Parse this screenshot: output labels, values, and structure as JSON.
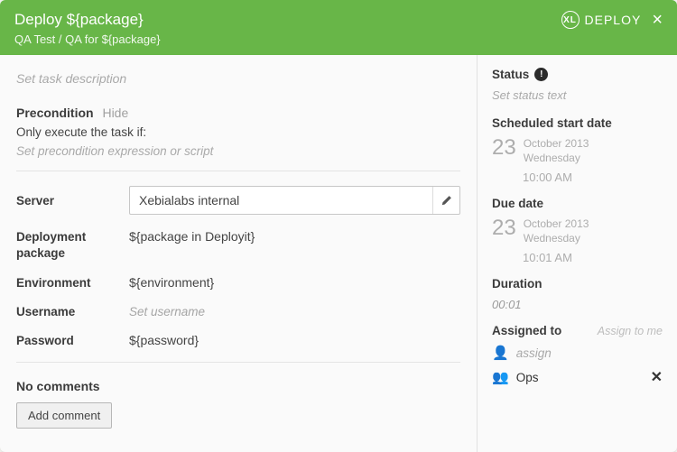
{
  "header": {
    "title": "Deploy ${package}",
    "breadcrumb": "QA Test / QA for ${package}",
    "logo_abbrev": "XL",
    "logo_text": "DEPLOY",
    "close": "×"
  },
  "main": {
    "description_placeholder": "Set task description",
    "precondition": {
      "label": "Precondition",
      "hide": "Hide",
      "subtitle": "Only execute the task if:",
      "placeholder": "Set precondition expression or script"
    },
    "fields": {
      "server": {
        "label": "Server",
        "value": "Xebialabs internal"
      },
      "deploy_pkg": {
        "label": "Deployment package",
        "value": "${package in Deployit}"
      },
      "environment": {
        "label": "Environment",
        "value": "${environment}"
      },
      "username": {
        "label": "Username",
        "placeholder": "Set username"
      },
      "password": {
        "label": "Password",
        "value": "${password}"
      }
    },
    "comments": {
      "no_comments": "No comments",
      "add": "Add comment"
    }
  },
  "side": {
    "status_label": "Status",
    "status_placeholder": "Set status text",
    "sched_label": "Scheduled start date",
    "sched": {
      "day": "23",
      "month_year": "October 2013",
      "weekday": "Wednesday",
      "time": "10:00 AM"
    },
    "due_label": "Due date",
    "due": {
      "day": "23",
      "month_year": "October 2013",
      "weekday": "Wednesday",
      "time": "10:01 AM"
    },
    "duration_label": "Duration",
    "duration_value": "00:01",
    "assigned_label": "Assigned to",
    "assign_to_me": "Assign to me",
    "assignee_placeholder": "assign",
    "ops": "Ops"
  }
}
